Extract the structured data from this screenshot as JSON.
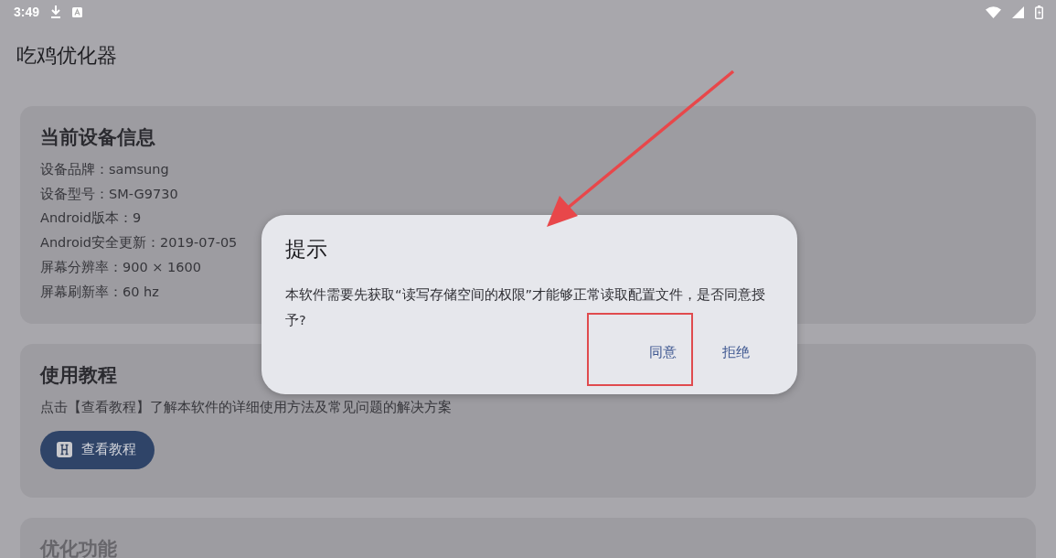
{
  "status_bar": {
    "time": "3:49"
  },
  "app_bar": {
    "title": "吃鸡优化器"
  },
  "cards": [
    {
      "kind": "info",
      "title": "当前设备信息",
      "lines": [
        "设备品牌：samsung",
        "设备型号：SM-G9730",
        "Android版本：9",
        "Android安全更新：2019-07-05",
        "屏幕分辨率：900 × 1600",
        "屏幕刷新率：60 hz"
      ]
    },
    {
      "kind": "tutorial",
      "title": "使用教程",
      "description": "点击【查看教程】了解本软件的详细使用方法及常见问题的解决方案",
      "button": "查看教程"
    },
    {
      "kind": "features",
      "title": "优化功能"
    }
  ],
  "dialog": {
    "title": "提示",
    "message": "本软件需要先获取“读写存储空间的权限”才能够正常读取配置文件，是否同意授予?",
    "buttons": [
      {
        "label": "同意",
        "highlighted": true
      },
      {
        "label": "拒绝",
        "highlighted": false
      }
    ]
  }
}
